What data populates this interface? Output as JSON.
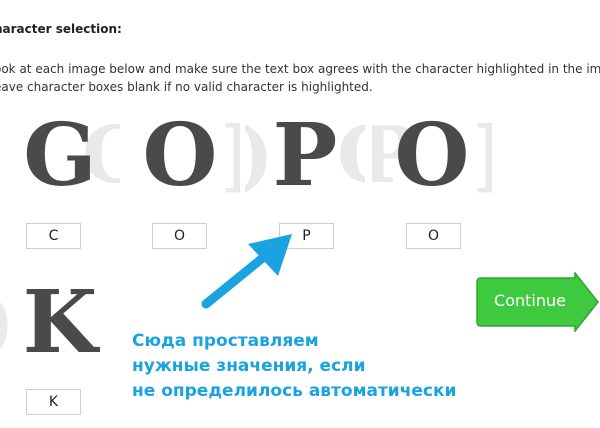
{
  "heading": "haracter selection:",
  "instructions": [
    "ook at each image below and make sure the text box agrees with the character highlighted in the image.",
    "eave character boxes blank if no valid character is highlighted."
  ],
  "glyphs": [
    {
      "main": "G",
      "left_ghost": "",
      "right_ghost": "C",
      "value": "C"
    },
    {
      "main": "O",
      "left_ghost": "",
      "right_ghost": "]",
      "value": "O"
    },
    {
      "main": "P",
      "left_ghost": ")",
      "right_ghost": "O",
      "value": "P"
    },
    {
      "main": "O",
      "left_ghost": "P",
      "right_ghost": "]",
      "value": "O"
    },
    {
      "main": "K",
      "left_ghost": ")",
      "right_ghost": "",
      "value": "K"
    }
  ],
  "note_lines": [
    "Сюда проставляем",
    "нужные значения, если",
    "не определилось автоматически"
  ],
  "continue_label": "Continue",
  "colors": {
    "note": "#1aa3e0",
    "arrow": "#1aa3e0",
    "continue_bg": "#3fc93f",
    "continue_border": "#2fa52f"
  },
  "icons": {
    "pointer": "arrow-up-right-icon",
    "continue": "arrow-right-icon"
  }
}
